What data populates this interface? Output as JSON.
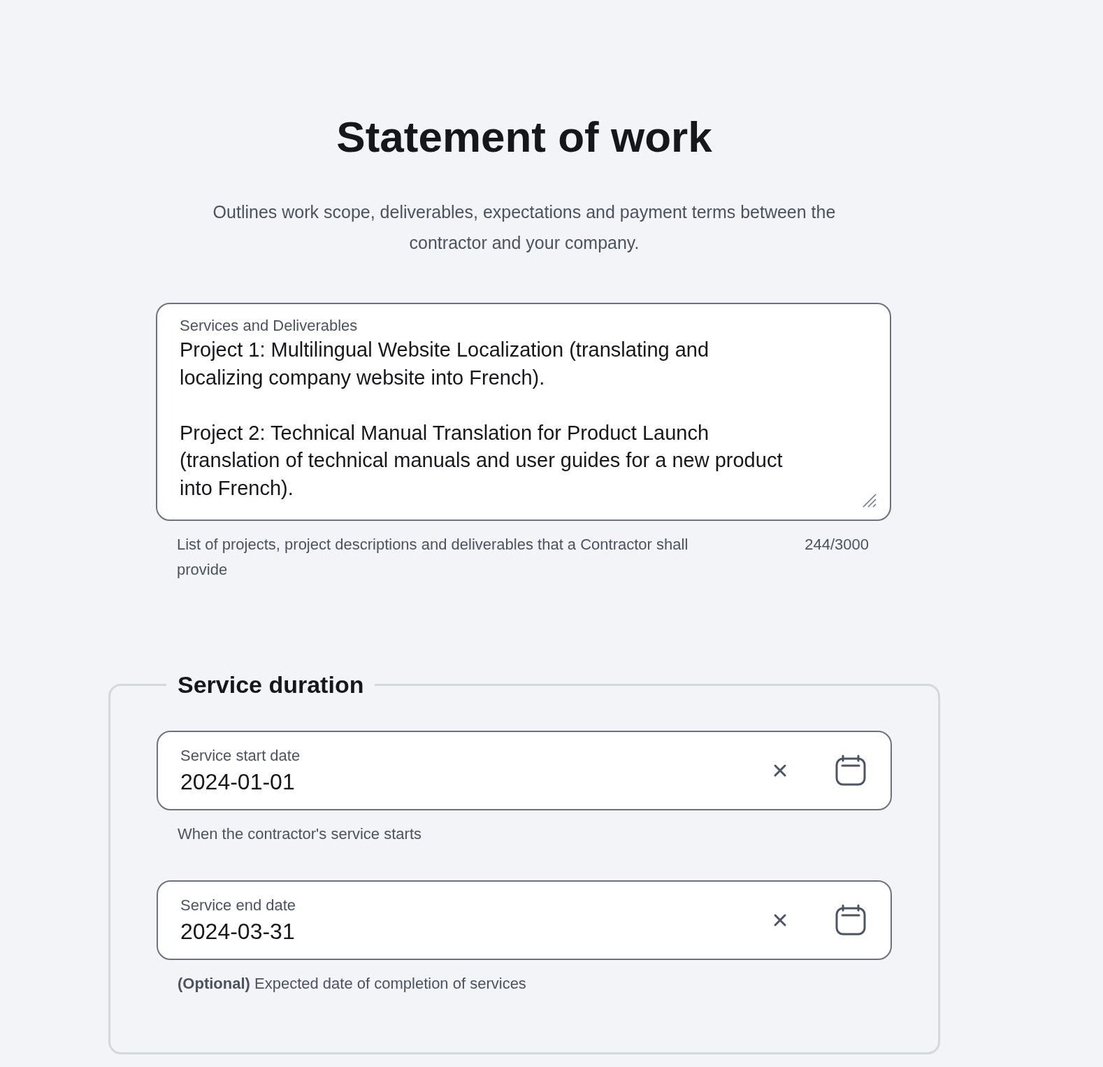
{
  "title": "Statement of work",
  "subtitle": "Outlines work scope, deliverables, expectations and payment terms between the contractor and your company.",
  "services": {
    "label": "Services and Deliverables",
    "value": "Project 1: Multilingual Website Localization (translating and localizing company website into French).\n\nProject 2: Technical Manual Translation for Product Launch (translation of technical manuals and user guides for a new product into French).",
    "hint": "List of projects, project descriptions and deliverables that a Contractor shall provide",
    "counter": "244/3000"
  },
  "service_duration": {
    "legend": "Service duration",
    "fields": [
      {
        "label": "Service start date",
        "value": "2024-01-01",
        "hint": "When the contractor's service starts"
      },
      {
        "label": "Service end date",
        "value": "2024-03-31",
        "hint": "**(Optional)** Expected date of completion of services"
      }
    ]
  }
}
